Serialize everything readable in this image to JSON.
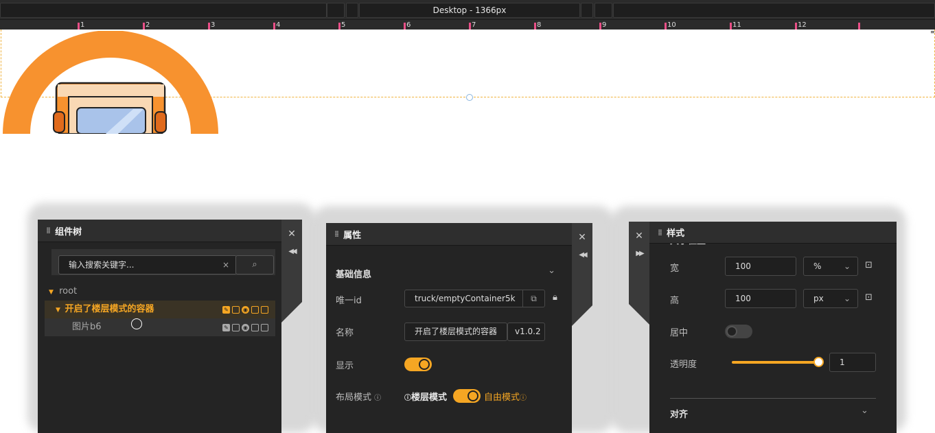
{
  "topbar": {
    "title": "Desktop - 1366px"
  },
  "ruler": {
    "labels": [
      "1",
      "2",
      "3",
      "4",
      "5",
      "6",
      "7",
      "8",
      "9",
      "10",
      "11",
      "12"
    ]
  },
  "left_panel": {
    "title": "组件树",
    "search_placeholder": "输入搜索关键字...",
    "tree": {
      "root": "root",
      "container": "开启了楼层模式的容器",
      "image": "图片b6"
    },
    "side_close": "✕",
    "side_collapse": "◀◀"
  },
  "mid_panel": {
    "title": "属性",
    "section": "基础信息",
    "id_label": "唯一id",
    "id_value": "truck/emptyContainer5k",
    "name_label": "名称",
    "name_value": "开启了楼层模式的容器",
    "version": "v1.0.2",
    "show_label": "显示",
    "layout_label": "布局模式",
    "floor_mode": "楼层模式",
    "free_mode": "自由模式",
    "side_close": "✕",
    "side_collapse": "◀◀"
  },
  "right_panel": {
    "title": "样式",
    "partial_heading": "大小位置",
    "width_label": "宽",
    "width_value": "100",
    "width_unit": "%",
    "height_label": "高",
    "height_value": "100",
    "height_unit": "px",
    "center_label": "居中",
    "opacity_label": "透明度",
    "opacity_value": "1",
    "align_label": "对齐",
    "side_close": "✕",
    "side_expand": "▶▶"
  },
  "colors": {
    "accent": "#f5a623",
    "panel": "#242424",
    "pink_tick": "#e94f87",
    "logo_orange": "#f7922f"
  }
}
